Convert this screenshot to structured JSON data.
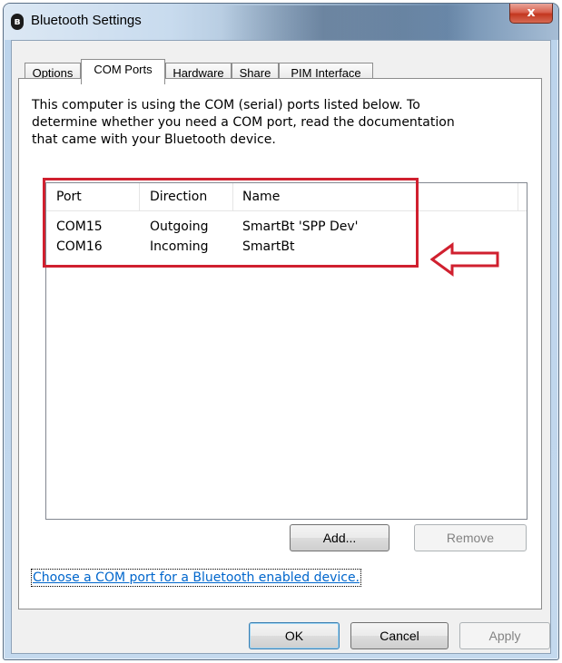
{
  "window": {
    "title": "Bluetooth Settings",
    "close_label": "x"
  },
  "tabs": [
    {
      "label": "Options",
      "active": false
    },
    {
      "label": "COM Ports",
      "active": true
    },
    {
      "label": "Hardware",
      "active": false
    },
    {
      "label": "Share",
      "active": false
    },
    {
      "label": "PIM Interface",
      "active": false
    }
  ],
  "com_ports": {
    "description_lines": [
      "This computer is using the COM (serial) ports listed below. To",
      "determine whether you need a COM port, read the documentation",
      "that came with your Bluetooth device."
    ],
    "columns": [
      "Port",
      "Direction",
      "Name"
    ],
    "rows": [
      {
        "port": "COM15",
        "direction": "Outgoing",
        "name": "SmartBt 'SPP Dev'"
      },
      {
        "port": "COM16",
        "direction": "Incoming",
        "name": "SmartBt"
      }
    ],
    "add_label": "Add...",
    "remove_label": "Remove",
    "link_text": "Choose a COM port for a Bluetooth enabled device."
  },
  "footer": {
    "ok_label": "OK",
    "cancel_label": "Cancel",
    "apply_label": "Apply"
  },
  "colors": {
    "highlight": "#d0202f",
    "link": "#0066cc"
  }
}
